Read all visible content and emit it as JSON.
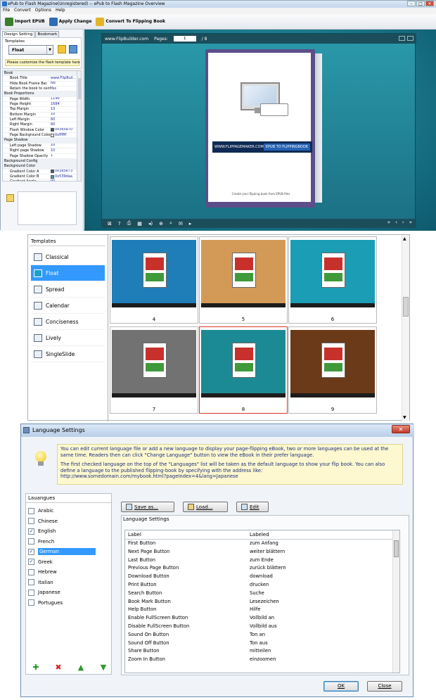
{
  "app": {
    "title": "ePub to Flash Magazine(Unregistered) -- ePub to Flash Magazine Overview",
    "menu": [
      "File",
      "Convert",
      "Options",
      "Help"
    ],
    "toolbar": {
      "import": "Import EPUB",
      "apply": "Apply Change",
      "convert": "Convert To Flipping Book"
    },
    "left_tabs": [
      "Design Setting",
      "Bookmark"
    ],
    "templates_label": "Templates",
    "template_selected": "Float",
    "customize_note": "Please customize the flash template here",
    "properties": [
      {
        "k": "Book",
        "v": "",
        "group": true
      },
      {
        "k": "Book Title",
        "v": "www.FlipBuil..."
      },
      {
        "k": "Hide Book Frame Bar",
        "v": "No"
      },
      {
        "k": "Retain the book to center",
        "v": "Yes"
      },
      {
        "k": "Book Proportions",
        "v": "",
        "group": true
      },
      {
        "k": "Page Width",
        "v": "1190"
      },
      {
        "k": "Page Height",
        "v": "1684"
      },
      {
        "k": "Top Margin",
        "v": "10"
      },
      {
        "k": "Bottom Margin",
        "v": "10"
      },
      {
        "k": "Left Margin",
        "v": "60"
      },
      {
        "k": "Right Margin",
        "v": "60"
      },
      {
        "k": "Flash Window Color",
        "v": "0x365a70",
        "color": "#365a70"
      },
      {
        "k": "Page Background Color",
        "v": "0xffffff",
        "color": "#ffffff"
      },
      {
        "k": "Page Shadow",
        "v": "",
        "group": true
      },
      {
        "k": "Left page Shadow",
        "v": "10"
      },
      {
        "k": "Right page Shadow",
        "v": "10"
      },
      {
        "k": "Page Shadow Opacity",
        "v": "1"
      },
      {
        "k": "Background Config",
        "v": "",
        "group": true
      },
      {
        "k": "Background Color",
        "v": "",
        "group": true
      },
      {
        "k": "Gradient Color A",
        "v": "0x385e73",
        "color": "#385e73"
      },
      {
        "k": "Gradient Color B",
        "v": "0x539daa",
        "color": "#539daa"
      },
      {
        "k": "Gradient Angle",
        "v": "90"
      }
    ],
    "viewer": {
      "site": "www.FlipBuilder.com",
      "pages_label": "Pages:",
      "page_value": "1",
      "page_total": "/ 8",
      "banner_left": "WWW.FLIPPAGEMAKER.COM",
      "banner_right": "EPUB TO FLIPPINGBOOK",
      "cover_footer": "Create your flipping book from EPUB files"
    }
  },
  "templates_panel": {
    "heading": "Templates",
    "items": [
      "Classical",
      "Float",
      "Spread",
      "Calendar",
      "Conciseness",
      "Lively",
      "SingleSlide"
    ],
    "selected_index": 1,
    "thumbs": [
      {
        "num": "4",
        "bg": "#1f7db8"
      },
      {
        "num": "5",
        "bg": "#d39a57"
      },
      {
        "num": "6",
        "bg": "#1a9db5"
      },
      {
        "num": "7",
        "bg": "#727272"
      },
      {
        "num": "8",
        "bg": "#1b8a94"
      },
      {
        "num": "9",
        "bg": "#6b3a18"
      }
    ],
    "selected_thumb": "8"
  },
  "language_dialog": {
    "title": "Language Settings",
    "close": "✕",
    "info_p1": "You can edit current language file or add a new language to display your page-flipping eBook, two or more languages can be used at the same time. Readers then can click \"Change Language\" button to view the eBook in their prefer language.",
    "info_p2": "The first checked language on the top of the \"Languages\" list will be taken as the default language to show your flip book. You can also define a language to the published flipping-book by specifying with the address like:",
    "info_url": "http://www.somedomain.com/mybook.html?pageIndex=4&lang=Japanese",
    "languages_header": "Lauangues",
    "languages": [
      {
        "name": "Arabic",
        "checked": false
      },
      {
        "name": "Chinese",
        "checked": false
      },
      {
        "name": "English",
        "checked": true
      },
      {
        "name": "French",
        "checked": false
      },
      {
        "name": "German",
        "checked": true,
        "selected": true
      },
      {
        "name": "Greek",
        "checked": true
      },
      {
        "name": "Hebrew",
        "checked": false
      },
      {
        "name": "Italian",
        "checked": false
      },
      {
        "name": "Japanese",
        "checked": false
      },
      {
        "name": "Portugues",
        "checked": false
      }
    ],
    "buttons": {
      "save": "Save as...",
      "load": "Load...",
      "edit": "Edit",
      "ok": "OK",
      "close": "Close"
    },
    "settings_label": "Language Settings",
    "col_label": "Label",
    "col_labeled": "Labeled",
    "rows": [
      [
        "First Button",
        "zum Anfang"
      ],
      [
        "Next Page Button",
        "weiter blättern"
      ],
      [
        "Last Button",
        "zum Ende"
      ],
      [
        "Previous Page Button",
        "zurück blättern"
      ],
      [
        "Download Button",
        "download"
      ],
      [
        "Print Button",
        "drucken"
      ],
      [
        "Search Button",
        "Suche"
      ],
      [
        "Book Mark Button",
        "Lesezeichen"
      ],
      [
        "Help Button",
        "Hilfe"
      ],
      [
        "Enable FullScreen Button",
        "Vollbild an"
      ],
      [
        "Disable FullScreen Button",
        "Vollbild aus"
      ],
      [
        "Sound On Button",
        "Ton an"
      ],
      [
        "Sound Off Button",
        "Ton aus"
      ],
      [
        "Share Button",
        "mitteilen"
      ],
      [
        "Zoom In Button",
        "einzoomen"
      ]
    ]
  }
}
